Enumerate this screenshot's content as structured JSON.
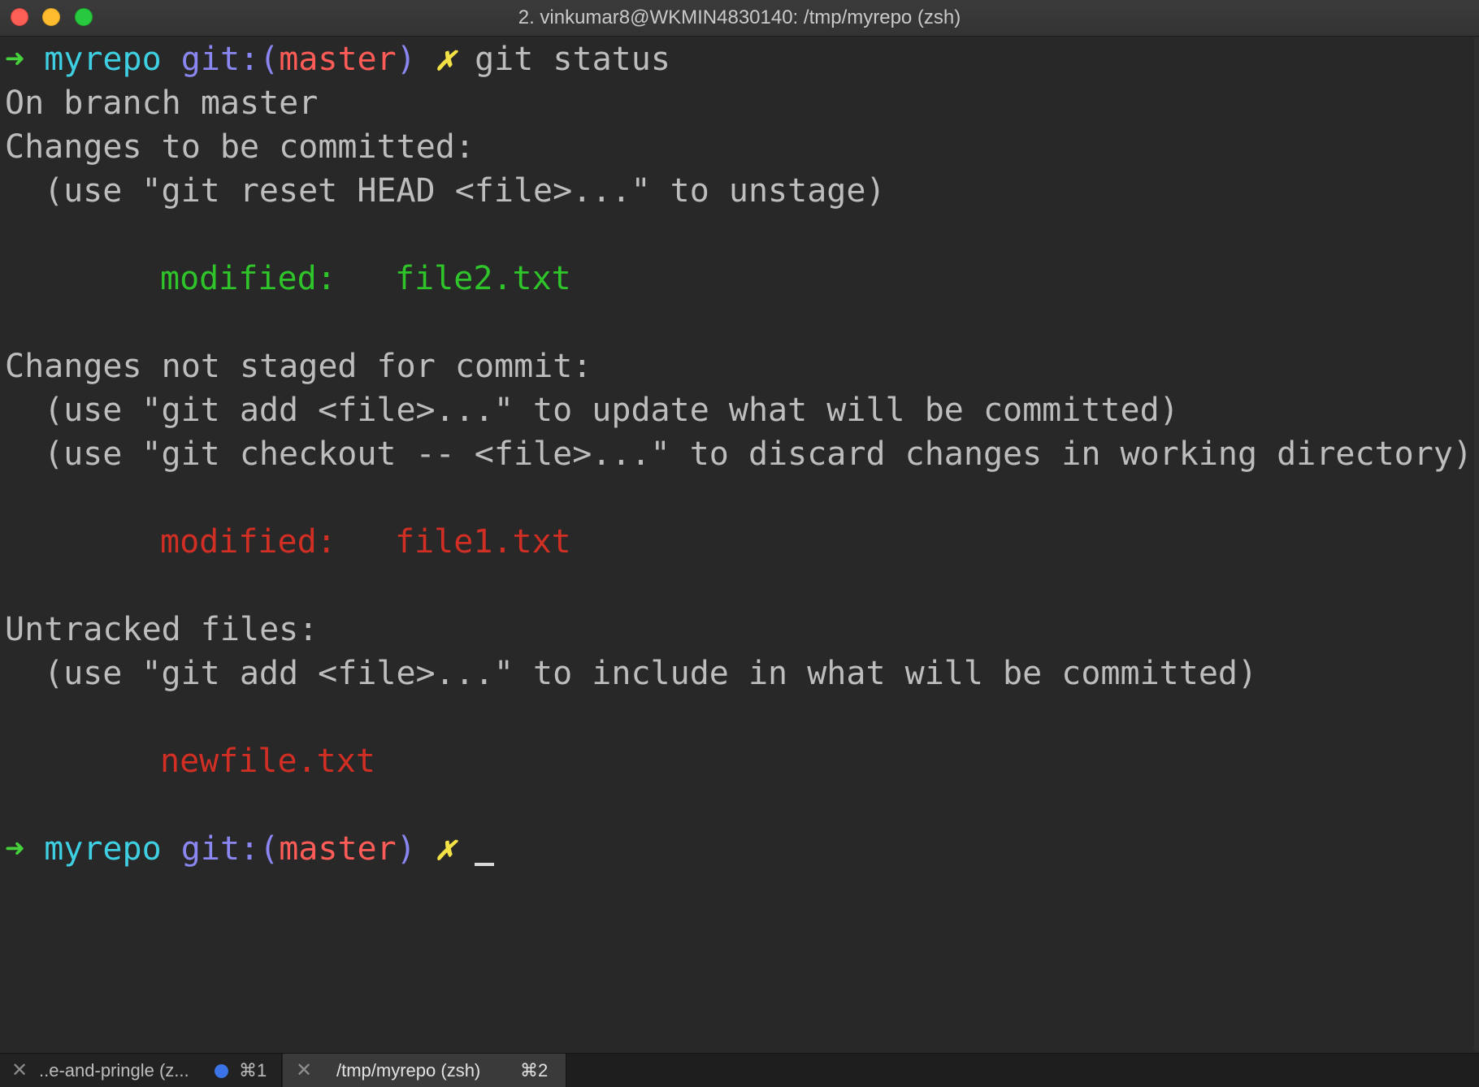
{
  "window": {
    "title": "2. vinkumar8@WKMIN4830140: /tmp/myrepo (zsh)"
  },
  "prompt": {
    "arrow": "➜",
    "repo": "myrepo",
    "git_prefix": "git:(",
    "branch": "master",
    "git_suffix": ")",
    "dirty_mark": "✗"
  },
  "terminal": {
    "command": "git status",
    "output": {
      "on_branch": "On branch master",
      "staged_header": "Changes to be committed:",
      "staged_hint": "(use \"git reset HEAD <file>...\" to unstage)",
      "staged_files": [
        {
          "status": "modified:",
          "file": "file2.txt"
        }
      ],
      "unstaged_header": "Changes not staged for commit:",
      "unstaged_hint_1": "(use \"git add <file>...\" to update what will be committed)",
      "unstaged_hint_2": "(use \"git checkout -- <file>...\" to discard changes in working directory)",
      "unstaged_files": [
        {
          "status": "modified:",
          "file": "file1.txt"
        }
      ],
      "untracked_header": "Untracked files:",
      "untracked_hint": "(use \"git add <file>...\" to include in what will be committed)",
      "untracked_files": [
        "newfile.txt"
      ]
    }
  },
  "tabs": [
    {
      "label": "..e-and-pringle (z...",
      "shortcut": "⌘1",
      "close_icon": "✕",
      "has_activity_dot": true,
      "active": false
    },
    {
      "label": "/tmp/myrepo (zsh)",
      "shortcut": "⌘2",
      "close_icon": "✕",
      "has_activity_dot": false,
      "active": true
    }
  ],
  "colors": {
    "background": "#282828",
    "text": "#bdbdbd",
    "arrow": "#45d03c",
    "repo": "#3ed0e2",
    "git": "#8b87f2",
    "branch": "#ff5c57",
    "dirty": "#f3e246",
    "staged": "#2fc42a",
    "unstaged": "#d12e24",
    "activity_dot": "#3b74e6"
  }
}
